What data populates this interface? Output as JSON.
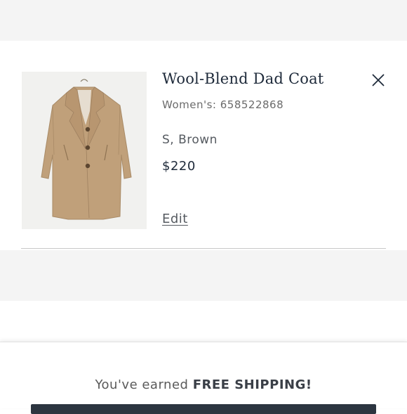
{
  "cart_item": {
    "title": "Wool-Blend Dad Coat",
    "sku": "Women's: 658522868",
    "variant": "S, Brown",
    "price": "$220",
    "edit_label": "Edit",
    "image_icon": "camel-coat-image",
    "close_icon": "close-icon"
  },
  "footer": {
    "shipping_prefix": "You've earned ",
    "shipping_highlight": "FREE SHIPPING!"
  },
  "colors": {
    "title_navy": "#1e2a3a",
    "coat_camel": "#c0a07a",
    "button_dark": "#2c3540",
    "band_gray": "#f4f4f4"
  }
}
